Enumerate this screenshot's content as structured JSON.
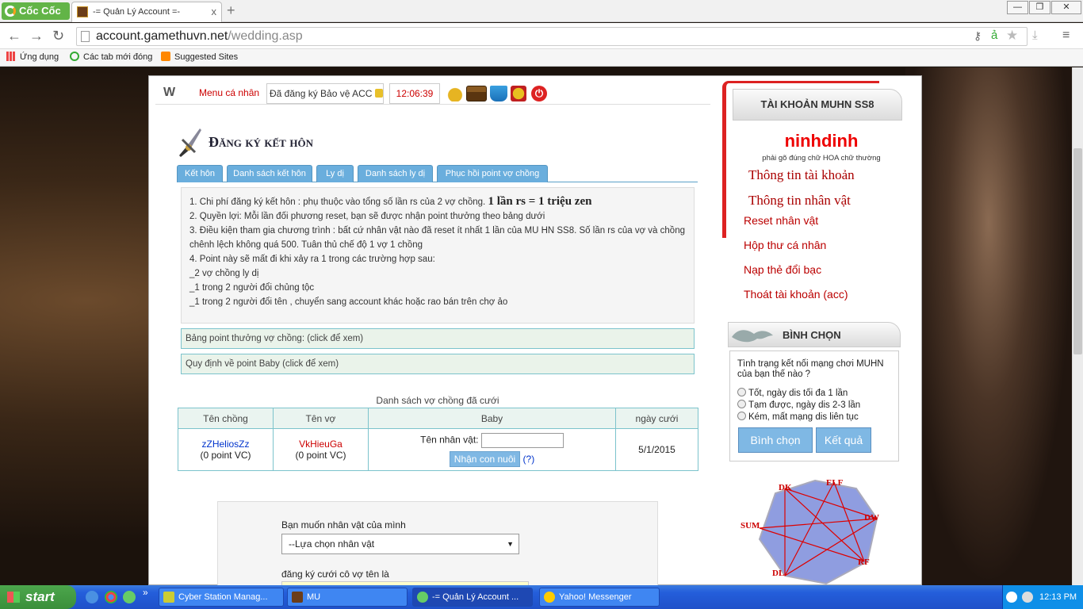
{
  "browser": {
    "brand": "Cốc Cốc",
    "tab_title": "-= Quản Lý Account =-",
    "tab_close": "x",
    "new_tab": "+",
    "url_host": "account.gamethuvn.net",
    "url_path": "/wedding.asp",
    "bookmarks": [
      "Ứng dụng",
      "Các tab mới đóng",
      "Suggested Sites"
    ],
    "window_controls": [
      "—",
      "❐",
      "✕"
    ]
  },
  "toolbar": {
    "logo": "W",
    "menu_label": "Menu cá nhân",
    "protect_status": "Đã đăng ký Bảo vệ ACC",
    "clock": "12:06:39",
    "icons": [
      "moneybag-icon",
      "chest-icon",
      "cart-icon",
      "trophy-icon",
      "power-icon"
    ]
  },
  "page": {
    "title": "Đăng ký kết hôn",
    "tabs": [
      "Kết hôn",
      "Danh sách kết hôn",
      "Ly dị",
      "Danh sách ly dị",
      "Phục hồi point vợ chồng"
    ],
    "rules": {
      "line1_prefix": "1. Chi phí đăng ký kết hôn : phụ thuộc vào tổng số lần rs của 2 vợ chồng.",
      "line1_big": "1 lần rs = 1 triệu zen",
      "line2": "2. Quyền lợi: Mỗi lần đối phương reset, bạn sẽ được nhận point thưởng theo bảng dưới",
      "line3": "3. Điều kiện tham gia chương trình : bất cứ nhân vật nào đã reset ít nhất 1 lần của MU HN SS8. Số lần rs của vợ và chồng chênh lệch không quá 500. Tuân thủ chế độ 1 vợ 1 chồng",
      "line4": "4. Point này sẽ mất đi khi xảy ra 1 trong các trường hợp sau:",
      "line5": "_2 vợ chồng ly dị",
      "line6": "_1 trong 2 người đổi chủng tộc",
      "line7": "_1 trong 2 người đổi tên , chuyển sang account khác hoặc rao bán trên chợ ảo"
    },
    "accordion_points": "Bảng point thưởng vợ chồng: (click để xem)",
    "accordion_baby": "Quy định về point Baby (click để xem)",
    "list_title": "Danh sách vợ chồng đã cưới",
    "table": {
      "headers": [
        "Tên chồng",
        "Tên vợ",
        "Baby",
        "ngày cưới"
      ],
      "row": {
        "husband": "zZHeliosZz",
        "husband_points": "(0 point VC)",
        "wife": "VkHieuGa",
        "wife_points": "(0 point VC)",
        "baby_label": "Tên nhân vật:",
        "baby_value": "",
        "adopt_button": "Nhận con nuôi",
        "help": "(?)",
        "date": "5/1/2015"
      }
    },
    "form": {
      "label_char": "Bạn muốn nhân vật của mình",
      "select_value": "--Lựa chọn nhân vật",
      "label_wife": "đăng ký cưới  cô vợ tên là"
    }
  },
  "sidebar": {
    "account_title": "TÀI KHOẢN MUHN SS8",
    "username": "ninhdinh",
    "case_note": "phải gõ đúng chữ HOA chữ thường",
    "links_big": [
      "Thông tin tài khoản",
      "Thông tin nhân vật"
    ],
    "links": [
      "Reset nhân vật",
      "Hộp thư cá nhân",
      "Nạp thẻ đổi bạc",
      "Thoát tài khoản (acc)"
    ],
    "vote_title": "BÌNH CHỌN",
    "vote_question": "Tình trạng kết nối mạng chơi MUHN của bạn thế nào ?",
    "vote_options": [
      "Tốt, ngày dis tối đa 1 lần",
      "Tạm được, ngày dis 2-3 lần",
      "Kém, mất mạng dis liên tục"
    ],
    "vote_button": "Bình chọn",
    "result_button": "Kết quả",
    "classes": [
      "DK",
      "ELF",
      "DW",
      "RF",
      "DL",
      "SUM"
    ]
  },
  "taskbar": {
    "start": "start",
    "tasks": [
      "Cyber Station Manag...",
      "MU",
      "-= Quản Lý Account ...",
      "Yahoo! Messenger"
    ],
    "clock": "12:13 PM",
    "more": "»"
  },
  "colors": {
    "accent_blue": "#6aaedd",
    "link_red": "#b00",
    "username_red": "#e00"
  }
}
